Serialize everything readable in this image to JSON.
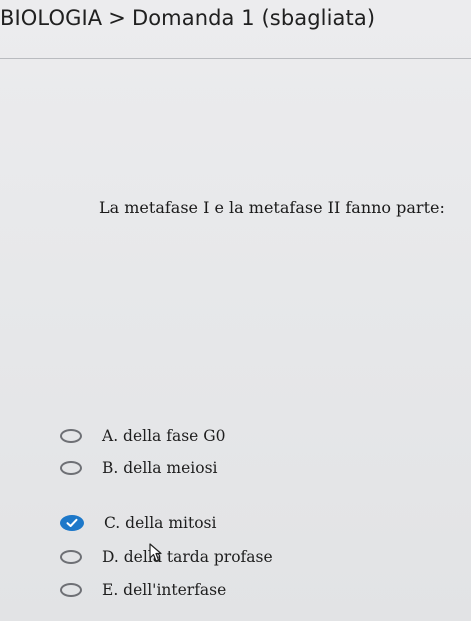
{
  "breadcrumb": {
    "subject": "BIOLOGIA",
    "separator": ">",
    "question_label": "Domanda 1 (sbagliata)"
  },
  "question": {
    "text": "La metafase I e la metafase II fanno parte:"
  },
  "options": [
    {
      "label": "A. della fase G0",
      "selected": false
    },
    {
      "label": "B. della meiosi",
      "selected": false
    },
    {
      "label": "C. della mitosi",
      "selected": true
    },
    {
      "label": "D. della tarda profase",
      "selected": false
    },
    {
      "label": "E. dell'interfase",
      "selected": false
    }
  ],
  "colors": {
    "selected_radio": "#1d78c9",
    "background": "#e9eaec"
  }
}
